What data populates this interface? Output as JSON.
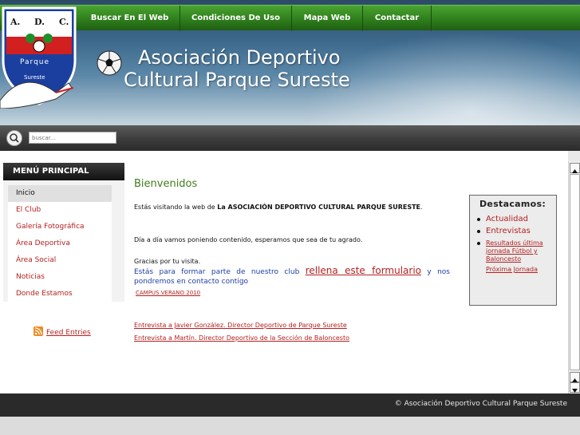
{
  "header": {
    "title_line1": "Asociación Deportivo",
    "title_line2": "Cultural Parque Sureste",
    "logo": {
      "letters_top": [
        "A.",
        "D.",
        "C."
      ],
      "word": "Parque",
      "word2": "Sureste"
    },
    "nav": [
      "Buscar En El Web",
      "Condiciones De Uso",
      "Mapa Web",
      "Contactar"
    ]
  },
  "search": {
    "placeholder": "buscar..."
  },
  "menu": {
    "title": "MENÚ PRINCIPAL",
    "items": [
      "Inicio",
      "El Club",
      "Galería Fotográfica",
      "Área Deportiva",
      "Área Social",
      "Noticias",
      "Donde Estamos"
    ],
    "active_index": 0
  },
  "feed": {
    "label": "Feed Entries"
  },
  "main": {
    "welcome": "Bienvenidos",
    "p1_prefix": "Estás visitando la web de ",
    "p1_bold": "La ASOCIACIÓN DEPORTIVO CULTURAL PARQUE SURESTE",
    "p1_suffix": ".",
    "p2": "Día a día vamos poniendo contenido, esperamos que sea de tu agrado.",
    "p3": "Gracias por tu visita.",
    "p4_prefix": "Está",
    "p4_middle": "s para formar parte de nuestro club",
    "p4_link": "rellena este formulario",
    "p4_suffix": " y nos pondremos en contacto contigo",
    "campus": "CAMPUS VERANO 2010",
    "news": [
      "Entrevista a Javier González. Director Deportivo de Parque Sureste",
      "Entrevista a Martín. Director Deportivo de la Sección de Baloncesto"
    ]
  },
  "destacamos": {
    "title": "Destacamos:",
    "items": [
      "Actualidad",
      "Entrevistas"
    ],
    "small_item": "Resultados última jornada Fútbol y Baloncesto",
    "small_item2": "Próxima Jornada"
  },
  "footer": {
    "text": "© Asociación Deportivo Cultural Parque Sureste"
  },
  "colors": {
    "nav_green": "#2f7f1d",
    "link_red": "#b52020",
    "welcome_green": "#3f7e1b",
    "blue_text": "#1f3fa3"
  }
}
